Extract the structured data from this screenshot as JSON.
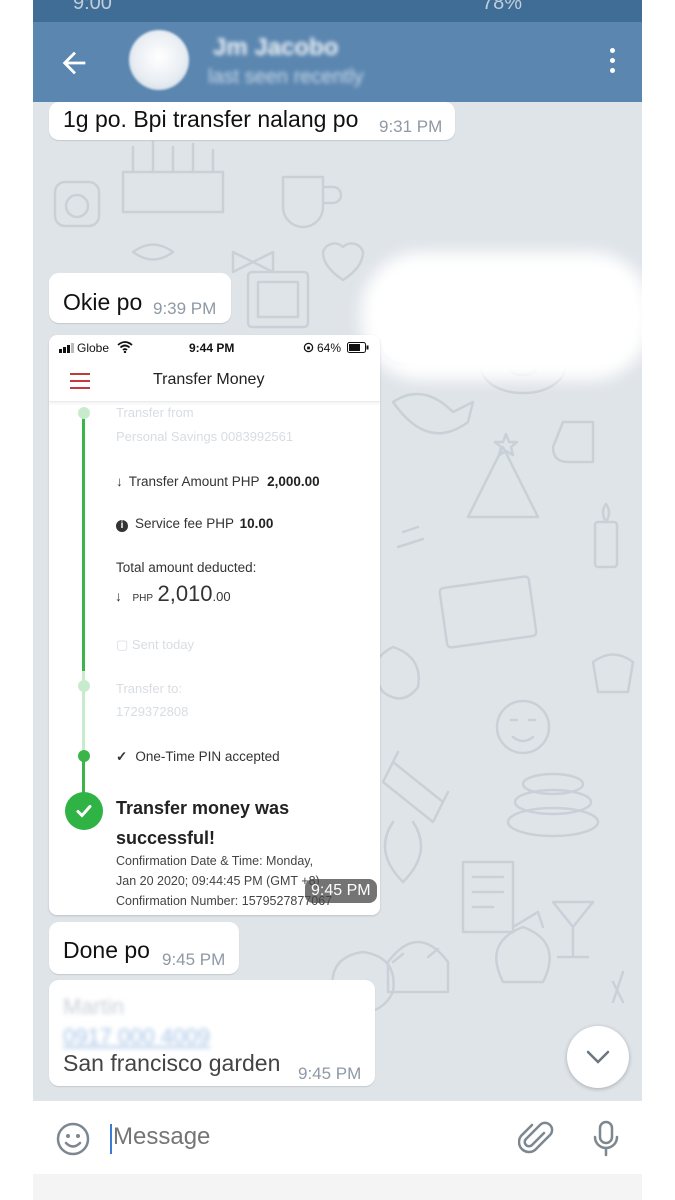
{
  "header": {
    "contact_name": "Jm Jacobo",
    "last_seen": "last seen recently"
  },
  "messages": [
    {
      "text": "1g po. Bpi transfer nalang po",
      "time": "9:31 PM"
    },
    {
      "text": "Okie po",
      "time": "9:39 PM"
    },
    {
      "text": "Done po",
      "time": "9:45 PM"
    },
    {
      "text": "San francisco garden",
      "time": "9:45 PM"
    }
  ],
  "screenshot": {
    "carrier": "Globe",
    "time": "9:44 PM",
    "battery": "64%",
    "title": "Transfer Money",
    "transfer_amount_label": "Transfer Amount PHP",
    "transfer_amount_value": "2,000.00",
    "service_fee_label": "Service fee PHP",
    "service_fee_value": "10.00",
    "total_label": "Total amount deducted:",
    "total_currency": "PHP",
    "total_whole": "2,010",
    "total_cents": ".00",
    "otp_text": "One-Time PIN accepted",
    "success_line1": "Transfer money was",
    "success_line2": "successful!",
    "confirm_line1": "Confirmation Date & Time: Monday,",
    "confirm_line2": "Jan 20 2020; 09:44:45 PM (GMT +8)",
    "confirm_line3": "Confirmation Number: 1579527877067",
    "image_time": "9:45 PM"
  },
  "input": {
    "placeholder": "Message"
  },
  "colors": {
    "header": "#5a86b0",
    "chat_bg": "#dfe4e9",
    "success_green": "#2fb344"
  }
}
